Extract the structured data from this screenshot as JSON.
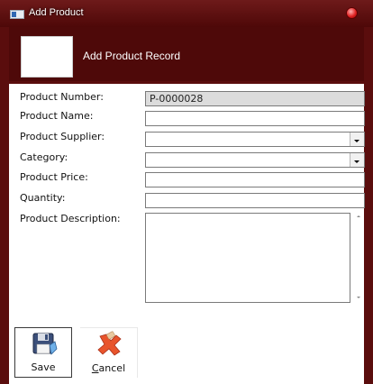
{
  "window": {
    "title": "Add Product"
  },
  "header": {
    "title": "Add Product Record"
  },
  "form": {
    "product_number": {
      "label": "Product Number:",
      "value": "P-0000028"
    },
    "product_name": {
      "label": "Product Name:",
      "value": ""
    },
    "product_supplier": {
      "label": "Product Supplier:",
      "value": ""
    },
    "category": {
      "label": "Category:",
      "value": ""
    },
    "product_price": {
      "label": "Product Price:",
      "value": ""
    },
    "quantity": {
      "label": "Quantity:",
      "value": ""
    },
    "product_description": {
      "label": "Product Description:",
      "value": ""
    }
  },
  "buttons": {
    "save": {
      "label": "Save",
      "icon": "floppy-disk-icon"
    },
    "cancel": {
      "label_underlined": "C",
      "label_rest": "ancel",
      "icon": "red-x-icon"
    }
  },
  "colors": {
    "title_bar": "#5a0d0d",
    "header_band": "#4e0909",
    "readonly_field": "#dcdcdc"
  }
}
